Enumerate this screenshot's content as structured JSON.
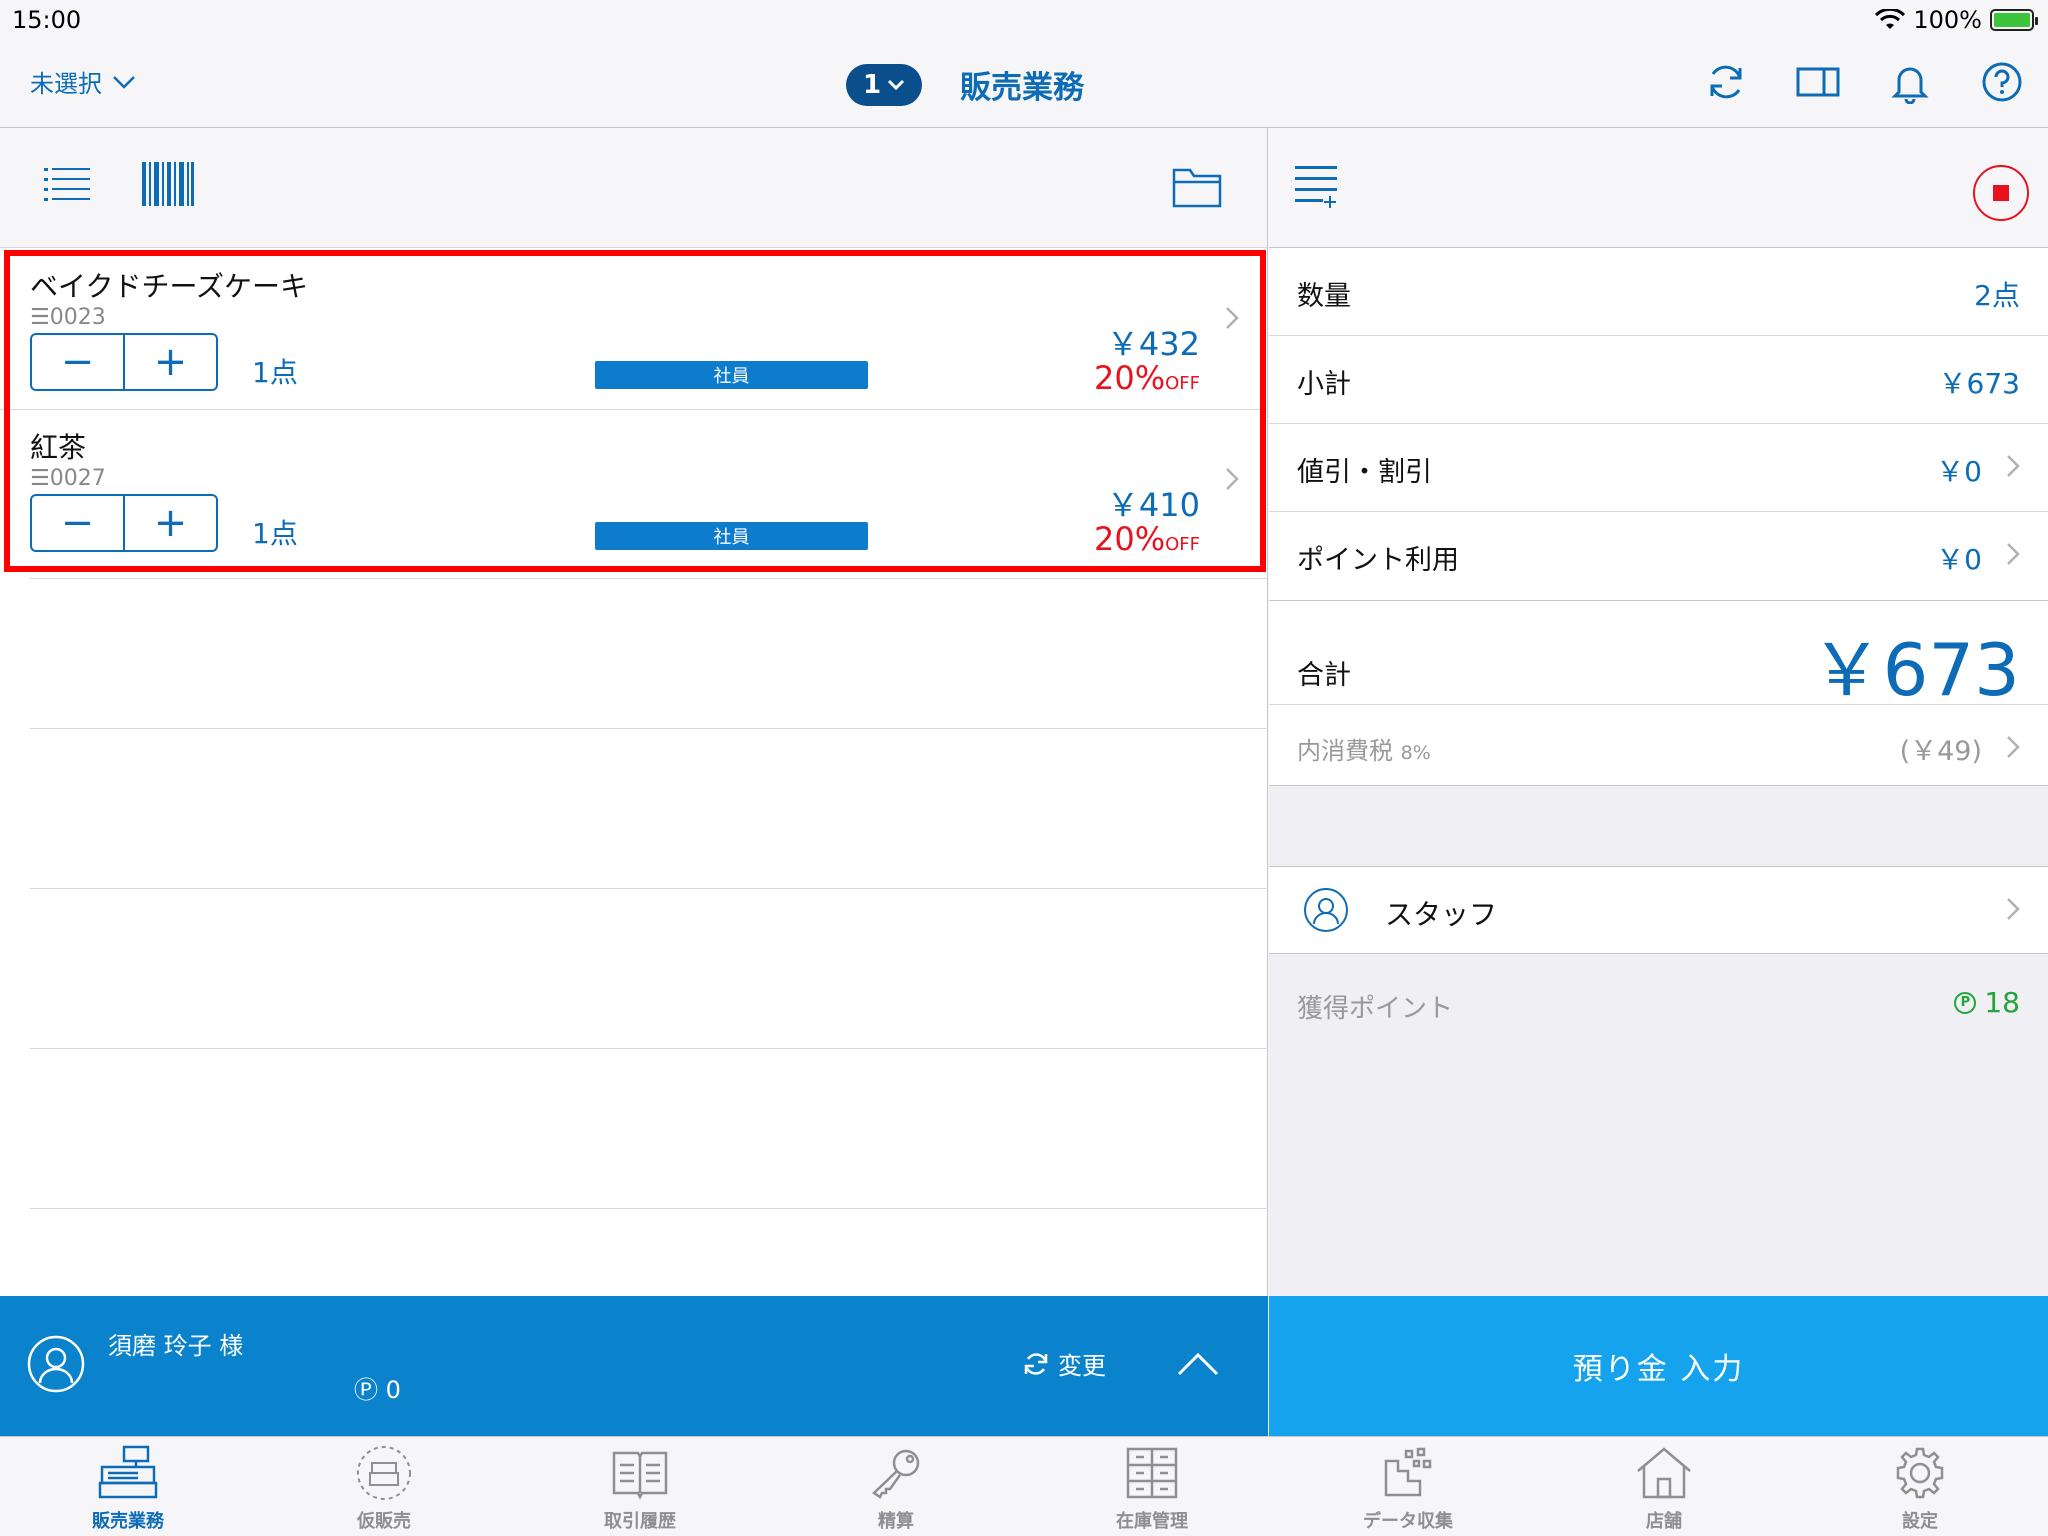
{
  "status": {
    "time": "15:00",
    "battery": "100%"
  },
  "nav": {
    "customer_select": "未選択",
    "register_number": "1",
    "title": "販売業務"
  },
  "items": [
    {
      "name": "ベイクドチーズケーキ",
      "code": "0023",
      "minus": "−",
      "plus": "+",
      "qty": "1点",
      "tag": "社員",
      "price": "￥432",
      "discount": "20%",
      "discount_suffix": "OFF"
    },
    {
      "name": "紅茶",
      "code": "0027",
      "minus": "−",
      "plus": "+",
      "qty": "1点",
      "tag": "社員",
      "price": "￥410",
      "discount": "20%",
      "discount_suffix": "OFF"
    }
  ],
  "customer": {
    "name": "須磨 玲子 様",
    "points": "0",
    "change_label": "変更"
  },
  "summary": {
    "quantity_label": "数量",
    "quantity_value": "2点",
    "subtotal_label": "小計",
    "subtotal_value": "￥673",
    "discount_label": "値引・割引",
    "discount_value": "￥0",
    "point_use_label": "ポイント利用",
    "point_use_value": "￥0",
    "total_label": "合計",
    "total_value": "￥673",
    "tax_label": "内消費税",
    "tax_rate": "8%",
    "tax_value": "(￥49)"
  },
  "staff": {
    "label": "スタッフ"
  },
  "earned_points": {
    "label": "獲得ポイント",
    "value": "18"
  },
  "deposit_button": "預り金 入力",
  "tabs": [
    {
      "label": "販売業務",
      "icon": "register-icon",
      "active": true
    },
    {
      "label": "仮販売",
      "icon": "temp-sale-icon",
      "active": false
    },
    {
      "label": "取引履歴",
      "icon": "history-icon",
      "active": false
    },
    {
      "label": "精算",
      "icon": "key-icon",
      "active": false
    },
    {
      "label": "在庫管理",
      "icon": "inventory-icon",
      "active": false
    },
    {
      "label": "データ収集",
      "icon": "data-collection-icon",
      "active": false
    },
    {
      "label": "店舗",
      "icon": "store-icon",
      "active": false
    },
    {
      "label": "設定",
      "icon": "settings-icon",
      "active": false
    }
  ],
  "colors": {
    "accent": "#0d6cb5",
    "customer_bar": "#0a82cc",
    "deposit": "#16a3ee",
    "discount": "#e8121e",
    "points": "#22a53c",
    "highlight": "#ff0000"
  }
}
